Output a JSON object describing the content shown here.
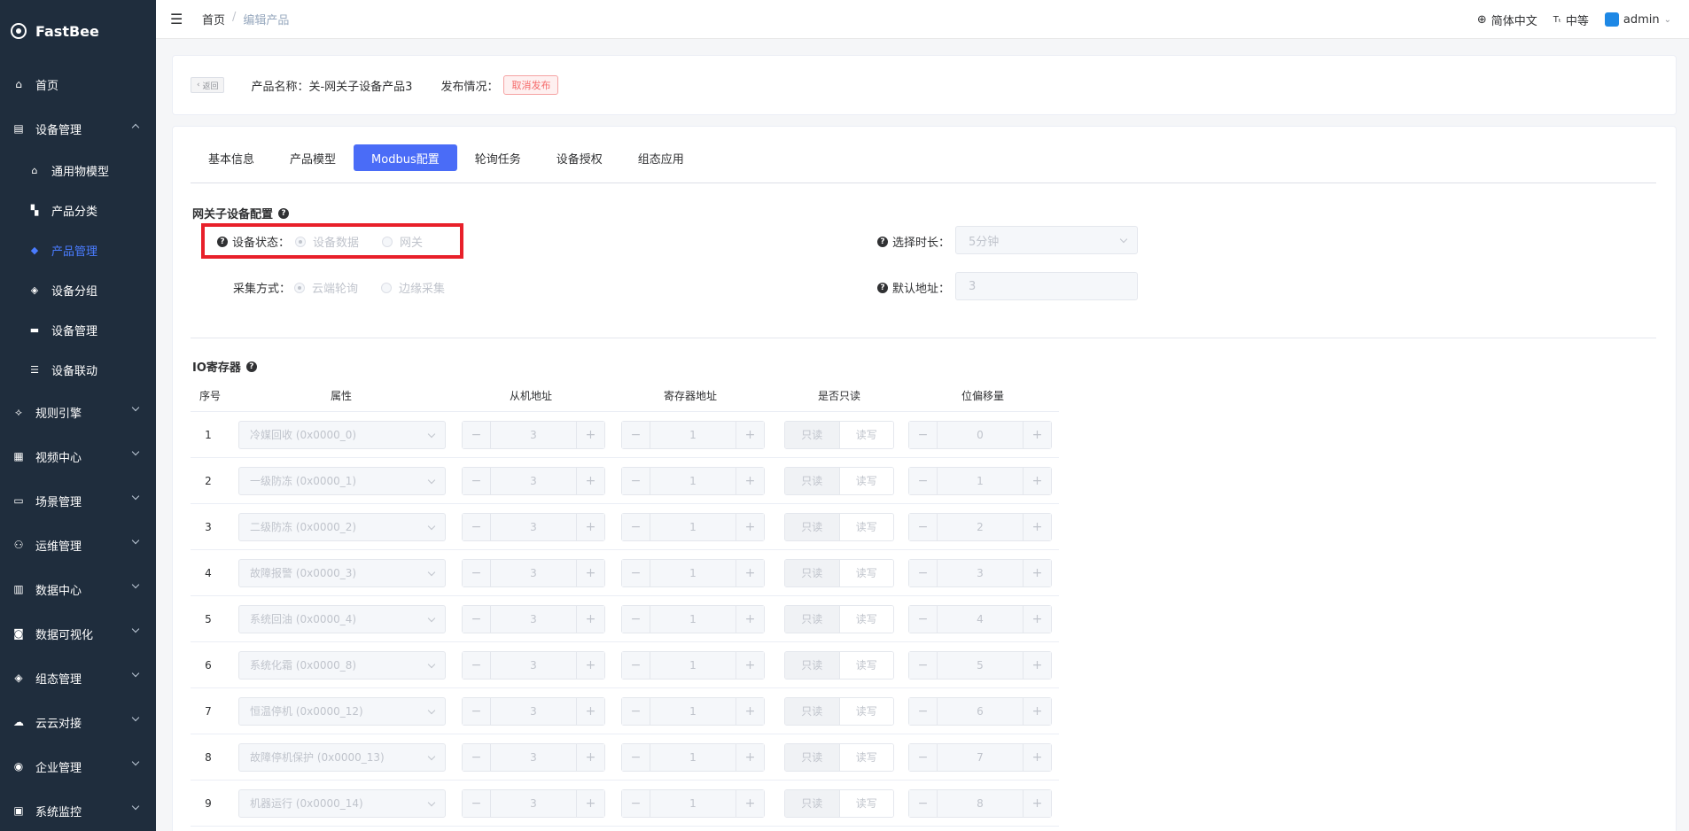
{
  "app": {
    "logo_text": "FastBee"
  },
  "sidebar": {
    "items": [
      {
        "label": "首页",
        "icon": "home-icon",
        "glyph": "⌂"
      },
      {
        "label": "设备管理",
        "icon": "device-icon",
        "glyph": "▤",
        "expanded": true
      },
      {
        "label": "规则引擎",
        "icon": "rule-icon",
        "glyph": "⟡"
      },
      {
        "label": "视频中心",
        "icon": "video-icon",
        "glyph": "▦"
      },
      {
        "label": "场景管理",
        "icon": "scene-icon",
        "glyph": "▭"
      },
      {
        "label": "运维管理",
        "icon": "ops-icon",
        "glyph": "⚇"
      },
      {
        "label": "数据中心",
        "icon": "data-icon",
        "glyph": "▥"
      },
      {
        "label": "数据可视化",
        "icon": "visual-icon",
        "glyph": "◙"
      },
      {
        "label": "组态管理",
        "icon": "config-icon",
        "glyph": "◈"
      },
      {
        "label": "云云对接",
        "icon": "cloud-icon",
        "glyph": "☁"
      },
      {
        "label": "企业管理",
        "icon": "company-icon",
        "glyph": "◉"
      },
      {
        "label": "系统监控",
        "icon": "monitor-icon",
        "glyph": "▣"
      }
    ],
    "sub_items": [
      {
        "label": "通用物模型",
        "icon": "model-icon",
        "glyph": "⌂"
      },
      {
        "label": "产品分类",
        "icon": "category-icon",
        "glyph": "▚"
      },
      {
        "label": "产品管理",
        "icon": "product-icon",
        "glyph": "◆",
        "active": true
      },
      {
        "label": "设备分组",
        "icon": "group-icon",
        "glyph": "◈"
      },
      {
        "label": "设备管理",
        "icon": "device-manage-icon",
        "glyph": "▬"
      },
      {
        "label": "设备联动",
        "icon": "linkage-icon",
        "glyph": "☰"
      }
    ]
  },
  "header": {
    "breadcrumb": [
      "首页",
      "编辑产品"
    ],
    "language": "简体中文",
    "font_size": "中等",
    "user": "admin"
  },
  "top_card": {
    "back_label": "返回",
    "product_name": "产品名称：关-网关子设备产品3",
    "publish_label": "发布情况：",
    "publish_tag": "取消发布"
  },
  "tabs": [
    {
      "label": "基本信息"
    },
    {
      "label": "产品模型"
    },
    {
      "label": "Modbus配置",
      "active": true
    },
    {
      "label": "轮询任务"
    },
    {
      "label": "设备授权"
    },
    {
      "label": "组态应用"
    }
  ],
  "gateway_config": {
    "title": "网关子设备配置",
    "device_status_label": "设备状态：",
    "device_status_options": [
      "设备数据",
      "网关"
    ],
    "collect_label": "采集方式：",
    "collect_options": [
      "云端轮询",
      "边缘采集"
    ],
    "duration_label": "选择时长：",
    "duration_value": "5分钟",
    "default_addr_label": "默认地址：",
    "default_addr_value": "3"
  },
  "io_register": {
    "title": "IO寄存器",
    "headers": [
      "序号",
      "属性",
      "从机地址",
      "寄存器地址",
      "是否只读",
      "位偏移量"
    ],
    "readonly_label": "只读",
    "readwrite_label": "读写",
    "rows": [
      {
        "idx": "1",
        "attr": "冷媒回收 (0x0000_0)",
        "slave": "3",
        "reg": "1",
        "offset": "0"
      },
      {
        "idx": "2",
        "attr": "一级防冻 (0x0000_1)",
        "slave": "3",
        "reg": "1",
        "offset": "1"
      },
      {
        "idx": "3",
        "attr": "二级防冻 (0x0000_2)",
        "slave": "3",
        "reg": "1",
        "offset": "2"
      },
      {
        "idx": "4",
        "attr": "故障报警 (0x0000_3)",
        "slave": "3",
        "reg": "1",
        "offset": "3"
      },
      {
        "idx": "5",
        "attr": "系统回油 (0x0000_4)",
        "slave": "3",
        "reg": "1",
        "offset": "4"
      },
      {
        "idx": "6",
        "attr": "系统化霜 (0x0000_8)",
        "slave": "3",
        "reg": "1",
        "offset": "5"
      },
      {
        "idx": "7",
        "attr": "恒温停机 (0x0000_12)",
        "slave": "3",
        "reg": "1",
        "offset": "6"
      },
      {
        "idx": "8",
        "attr": "故障停机保护 (0x0000_13)",
        "slave": "3",
        "reg": "1",
        "offset": "7"
      },
      {
        "idx": "9",
        "attr": "机器运行 (0x0000_14)",
        "slave": "3",
        "reg": "1",
        "offset": "8"
      }
    ]
  }
}
